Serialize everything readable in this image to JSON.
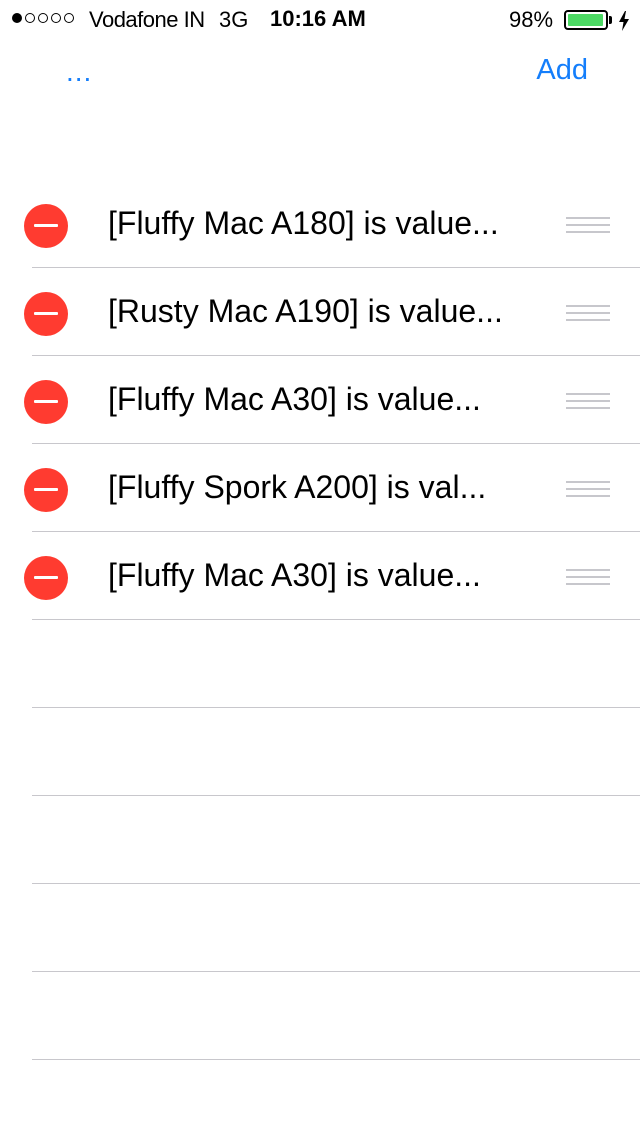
{
  "status_bar": {
    "signal_bars_filled": 1,
    "signal_bars_total": 5,
    "carrier": "Vodafone IN",
    "network": "3G",
    "time": "10:16 AM",
    "battery_percent_text": "98%",
    "battery_level": 0.98,
    "battery_color": "#4cd964"
  },
  "nav": {
    "left_label": "...",
    "right_label": "Add",
    "accent_color": "#147efb"
  },
  "list": {
    "items": [
      {
        "label": "[Fluffy Mac A180] is value..."
      },
      {
        "label": "[Rusty Mac A190] is value..."
      },
      {
        "label": "[Fluffy Mac A30] is value..."
      },
      {
        "label": "[Fluffy Spork A200] is val..."
      },
      {
        "label": "[Fluffy Mac A30] is value..."
      }
    ],
    "empty_rows": 5,
    "delete_color": "#ff3b30"
  }
}
